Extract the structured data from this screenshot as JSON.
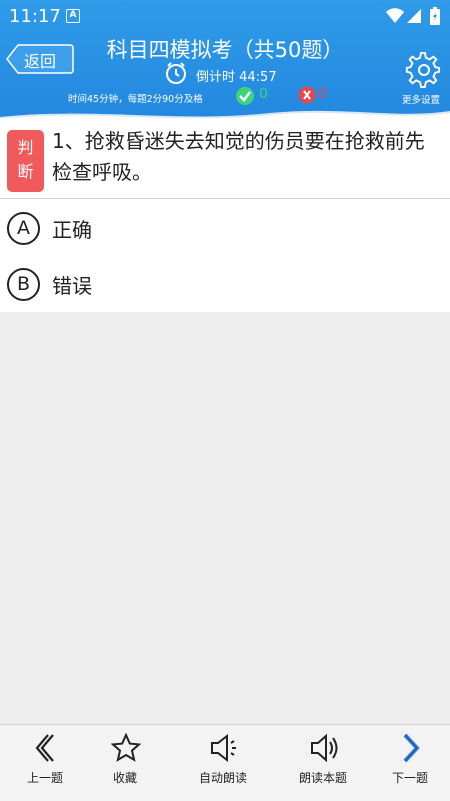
{
  "status_bar": {
    "time": "11:17",
    "notification_glyph": "A"
  },
  "header": {
    "back_label": "返回",
    "title": "科目四模拟考（共50题）",
    "countdown": "倒计时 44:57",
    "rules": "时间45分钟，每题2分90分及格",
    "correct_count": "0",
    "wrong_count": "0",
    "settings_label": "更多设置"
  },
  "question": {
    "type_label_line1": "判",
    "type_label_line2": "断",
    "text": "1、抢救昏迷失去知觉的伤员要在抢救前先检查呼吸。",
    "options": [
      {
        "letter": "A",
        "text": "正确"
      },
      {
        "letter": "B",
        "text": "错误"
      }
    ]
  },
  "bottom_nav": {
    "prev": "上一题",
    "favorite": "收藏",
    "auto_read": "自动朗读",
    "read_this": "朗读本题",
    "next": "下一题"
  },
  "colors": {
    "header_blue": "#2388df",
    "badge_red": "#f05a5b",
    "correct_green": "#3ed47a",
    "wrong_red": "#e4474f",
    "next_arrow_blue": "#2f7fe0"
  }
}
